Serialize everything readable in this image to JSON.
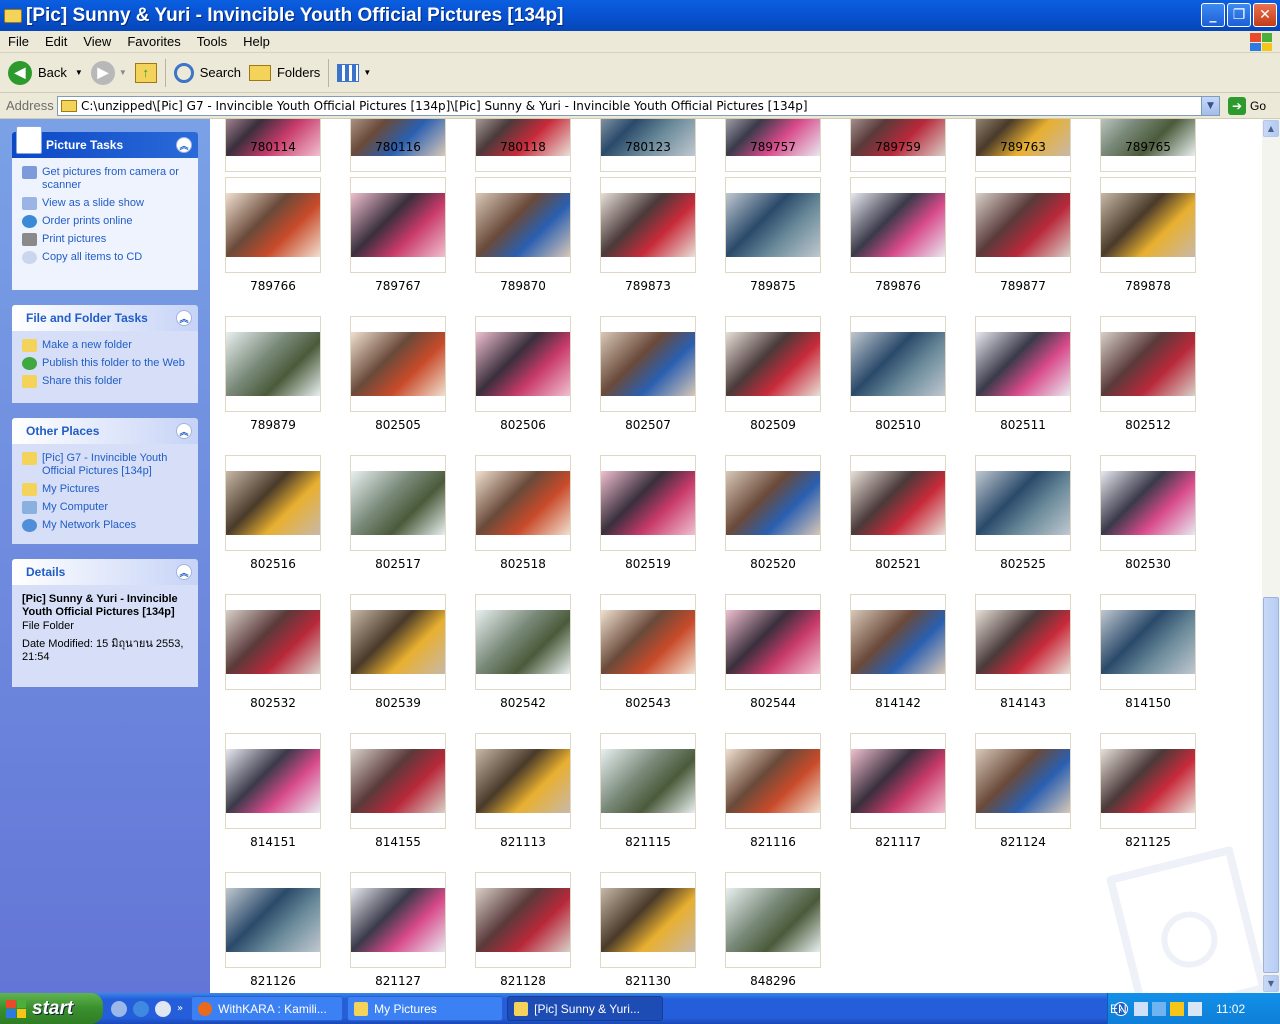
{
  "window": {
    "title": "[Pic] Sunny & Yuri - Invincible Youth Official Pictures [134p]"
  },
  "menu": [
    "File",
    "Edit",
    "View",
    "Favorites",
    "Tools",
    "Help"
  ],
  "toolbar": {
    "back": "Back",
    "search": "Search",
    "folders": "Folders"
  },
  "address": {
    "label": "Address",
    "value": "C:\\unzipped\\[Pic] G7 - Invincible Youth Official Pictures [134p]\\[Pic] Sunny & Yuri - Invincible Youth Official Pictures [134p]",
    "go": "Go"
  },
  "panels": {
    "picture_tasks": {
      "title": "Picture Tasks",
      "items": [
        "Get pictures from camera or scanner",
        "View as a slide show",
        "Order prints online",
        "Print pictures",
        "Copy all items to CD"
      ]
    },
    "file_folder_tasks": {
      "title": "File and Folder Tasks",
      "items": [
        "Make a new folder",
        "Publish this folder to the Web",
        "Share this folder"
      ]
    },
    "other_places": {
      "title": "Other Places",
      "items": [
        "[Pic] G7 - Invincible Youth Official Pictures [134p]",
        "My Pictures",
        "My Computer",
        "My Network Places"
      ]
    },
    "details": {
      "title": "Details",
      "name": "[Pic] Sunny & Yuri - Invincible Youth Official Pictures [134p]",
      "type": "File Folder",
      "modified": "Date Modified: 15 มิถุนายน 2553, 21:54"
    }
  },
  "files": [
    [
      "780114",
      "780116",
      "780118",
      "780123",
      "789757",
      "789759",
      "789763",
      "789765"
    ],
    [
      "789766",
      "789767",
      "789870",
      "789873",
      "789875",
      "789876",
      "789877",
      "789878"
    ],
    [
      "789879",
      "802505",
      "802506",
      "802507",
      "802509",
      "802510",
      "802511",
      "802512"
    ],
    [
      "802516",
      "802517",
      "802518",
      "802519",
      "802520",
      "802521",
      "802525",
      "802530"
    ],
    [
      "802532",
      "802539",
      "802542",
      "802543",
      "802544",
      "814142",
      "814143",
      "814150"
    ],
    [
      "814151",
      "814155",
      "821113",
      "821115",
      "821116",
      "821117",
      "821124",
      "821125"
    ],
    [
      "821126",
      "821127",
      "821128",
      "821130",
      "848296"
    ]
  ],
  "taskbar": {
    "start": "start",
    "tasks": [
      "WithKARA : Kamili...",
      "My Pictures",
      "[Pic] Sunny & Yuri..."
    ],
    "lang": "EN",
    "clock": "11:02"
  }
}
